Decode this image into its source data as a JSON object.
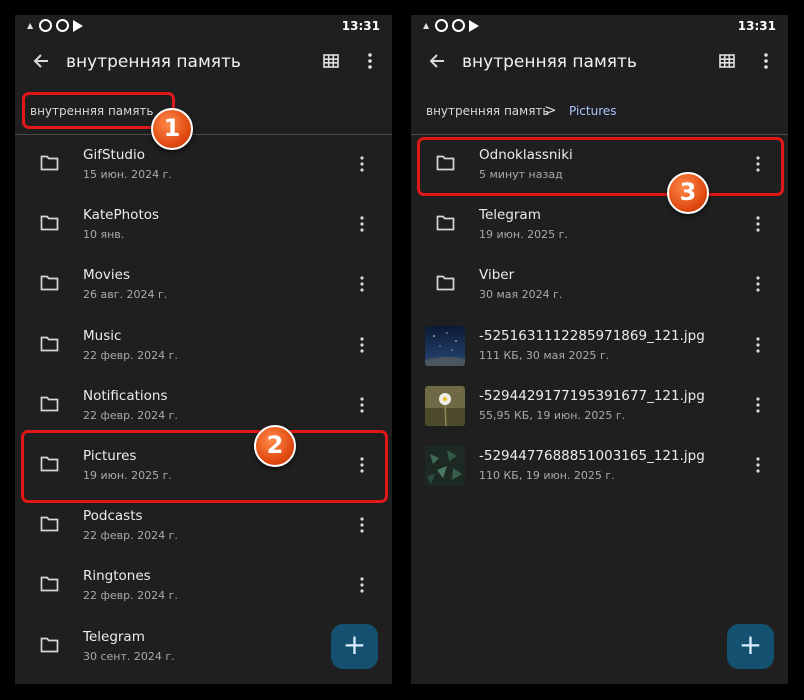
{
  "status_bar": {
    "time": "13:31"
  },
  "left_screen": {
    "title": "внутренняя память",
    "breadcrumb": {
      "root": "внутренняя память"
    },
    "items": [
      {
        "name": "GifStudio",
        "meta": "15 июн. 2024 г."
      },
      {
        "name": "KatePhotos",
        "meta": "10 янв."
      },
      {
        "name": "Movies",
        "meta": "26 авг. 2024 г."
      },
      {
        "name": "Music",
        "meta": "22 февр. 2024 г."
      },
      {
        "name": "Notifications",
        "meta": "22 февр. 2024 г."
      },
      {
        "name": "Pictures",
        "meta": "19 июн. 2025 г."
      },
      {
        "name": "Podcasts",
        "meta": "22 февр. 2024 г."
      },
      {
        "name": "Ringtones",
        "meta": "22 февр. 2024 г."
      },
      {
        "name": "Telegram",
        "meta": "30 сент. 2024 г."
      }
    ],
    "fab_label": "+"
  },
  "right_screen": {
    "title": "внутренняя память",
    "breadcrumb": {
      "root": "внутренняя память",
      "separator": ">",
      "current": "Pictures"
    },
    "items": [
      {
        "name": "Odnoklassniki",
        "meta": "5 минут назад",
        "type": "folder"
      },
      {
        "name": "Telegram",
        "meta": "19 июн. 2025 г.",
        "type": "folder"
      },
      {
        "name": "Viber",
        "meta": "30 мая 2024 г.",
        "type": "folder"
      },
      {
        "name": "-5251631112285971869_121.jpg",
        "meta": "111 КБ, 30 мая 2025 г.",
        "type": "image"
      },
      {
        "name": "-5294429177195391677_121.jpg",
        "meta": "55,95 КБ, 19 июн. 2025 г.",
        "type": "image"
      },
      {
        "name": "-5294477688851003165_121.jpg",
        "meta": "110 КБ, 19 июн. 2025 г.",
        "type": "image"
      }
    ],
    "fab_label": "+"
  },
  "annotations": {
    "step1": "1",
    "step2": "2",
    "step3": "3"
  },
  "colors": {
    "highlight": "#e01818",
    "badge": "#e0480f",
    "accent": "#a9c4ff",
    "fab": "#14506f"
  }
}
